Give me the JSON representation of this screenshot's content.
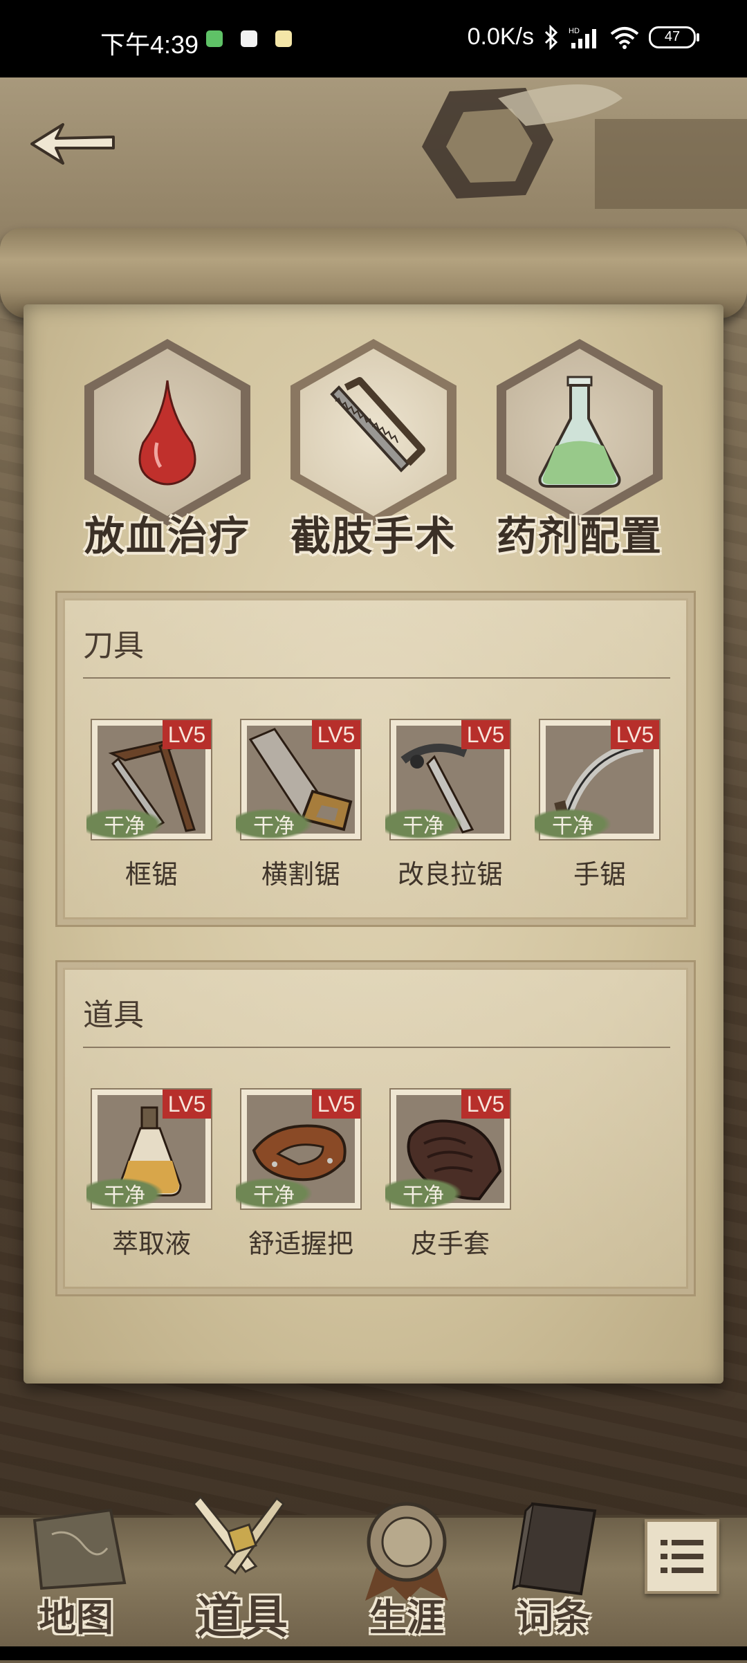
{
  "status_bar": {
    "time": "下午4:39",
    "network_speed": "0.0K/s",
    "battery": "47"
  },
  "surgery_types": [
    {
      "label": "放血治疗",
      "icon": "blood-drop-icon",
      "selected": false
    },
    {
      "label": "截肢手术",
      "icon": "saw-icon",
      "selected": true
    },
    {
      "label": "药剂配置",
      "icon": "flask-icon",
      "selected": false
    }
  ],
  "sections": {
    "blades": {
      "title": "刀具",
      "items": [
        {
          "name": "框锯",
          "level": "LV5",
          "status": "干净",
          "icon": "frame-saw-icon"
        },
        {
          "name": "横割锯",
          "level": "LV5",
          "status": "干净",
          "icon": "crosscut-saw-icon"
        },
        {
          "name": "改良拉锯",
          "level": "LV5",
          "status": "干净",
          "icon": "pull-saw-icon"
        },
        {
          "name": "手锯",
          "level": "LV5",
          "status": "干净",
          "icon": "hand-saw-icon"
        }
      ]
    },
    "tools": {
      "title": "道具",
      "items": [
        {
          "name": "萃取液",
          "level": "LV5",
          "status": "干净",
          "icon": "extract-bottle-icon"
        },
        {
          "name": "舒适握把",
          "level": "LV5",
          "status": "干净",
          "icon": "grip-icon"
        },
        {
          "name": "皮手套",
          "level": "LV5",
          "status": "干净",
          "icon": "leather-glove-icon"
        }
      ]
    }
  },
  "bottom_nav": [
    {
      "label": "地图",
      "active": false
    },
    {
      "label": "道具",
      "active": true
    },
    {
      "label": "生涯",
      "active": false
    },
    {
      "label": "词条",
      "active": false
    }
  ],
  "colors": {
    "level_badge": "#b72f2b",
    "clean_tag": "#6f8754",
    "paper": "#d2c49f"
  }
}
